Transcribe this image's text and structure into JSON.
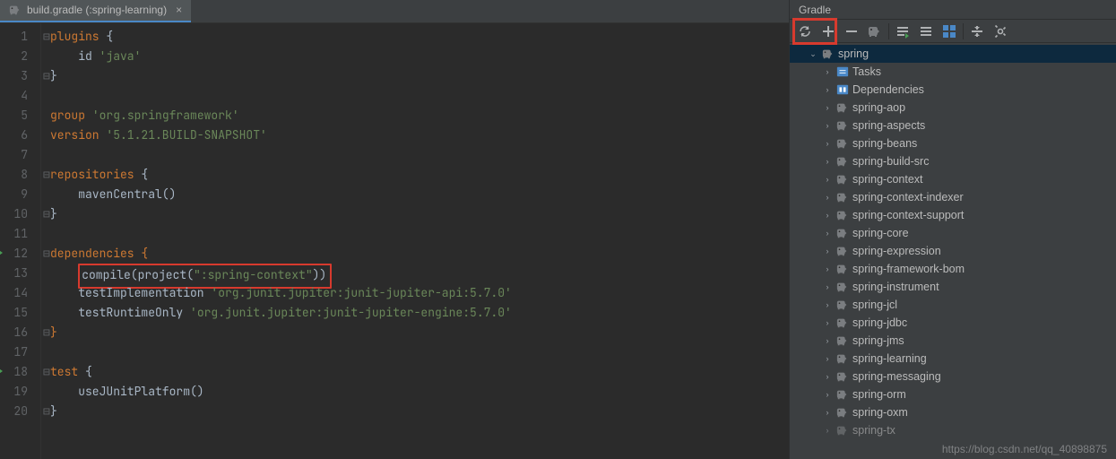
{
  "tab": {
    "label": "build.gradle (:spring-learning)"
  },
  "gutter": {
    "run_lines": [
      12,
      18
    ]
  },
  "code": {
    "lines": [
      {
        "n": 1,
        "fold": "⊟",
        "spans": [
          [
            "plugins ",
            "kw"
          ],
          [
            "{",
            "br"
          ]
        ]
      },
      {
        "n": 2,
        "spans": [
          [
            "    id ",
            "fn"
          ],
          [
            "'java'",
            "str"
          ]
        ]
      },
      {
        "n": 3,
        "fold": "⊟",
        "spans": [
          [
            "}",
            "br"
          ]
        ]
      },
      {
        "n": 4,
        "spans": []
      },
      {
        "n": 5,
        "spans": [
          [
            "group ",
            "kw"
          ],
          [
            "'org.springframework'",
            "str"
          ]
        ]
      },
      {
        "n": 6,
        "spans": [
          [
            "version ",
            "kw"
          ],
          [
            "'5.1.21.BUILD-SNAPSHOT'",
            "str"
          ]
        ]
      },
      {
        "n": 7,
        "spans": []
      },
      {
        "n": 8,
        "fold": "⊟",
        "spans": [
          [
            "repositories ",
            "kw"
          ],
          [
            "{",
            "br"
          ]
        ]
      },
      {
        "n": 9,
        "spans": [
          [
            "    mavenCentral()",
            "fn"
          ]
        ]
      },
      {
        "n": 10,
        "fold": "⊟",
        "spans": [
          [
            "}",
            "br"
          ]
        ]
      },
      {
        "n": 11,
        "spans": []
      },
      {
        "n": 12,
        "fold": "⊟",
        "spans": [
          [
            "dependencies ",
            "kw"
          ],
          [
            "{",
            "brc"
          ]
        ]
      },
      {
        "n": 13,
        "hl": true,
        "spans": [
          [
            "    compile(project(",
            "fn"
          ],
          [
            "\":spring-context\"",
            "str"
          ],
          [
            "))",
            "fn"
          ]
        ]
      },
      {
        "n": 14,
        "spans": [
          [
            "    testImplementation ",
            "fn"
          ],
          [
            "'org.junit.jupiter:junit-jupiter-api:5.7.0'",
            "str"
          ]
        ]
      },
      {
        "n": 15,
        "spans": [
          [
            "    testRuntimeOnly ",
            "fn"
          ],
          [
            "'org.junit.jupiter:junit-jupiter-engine:5.7.0'",
            "str"
          ]
        ]
      },
      {
        "n": 16,
        "fold": "⊟",
        "spans": [
          [
            "}",
            "brc"
          ]
        ]
      },
      {
        "n": 17,
        "spans": []
      },
      {
        "n": 18,
        "fold": "⊟",
        "spans": [
          [
            "test ",
            "kw"
          ],
          [
            "{",
            "br"
          ]
        ]
      },
      {
        "n": 19,
        "spans": [
          [
            "    useJUnitPlatform()",
            "fn"
          ]
        ]
      },
      {
        "n": 20,
        "fold": "⊟",
        "spans": [
          [
            "}",
            "br"
          ]
        ]
      }
    ]
  },
  "side": {
    "title": "Gradle",
    "toolbar": [
      "refresh",
      "add",
      "remove",
      "elephant",
      "sep",
      "execute",
      "toggle",
      "grid",
      "sep",
      "collapse",
      "settings"
    ],
    "tree": {
      "root": {
        "label": "spring",
        "icon": "elephant",
        "selected": true
      },
      "children": [
        {
          "label": "Tasks",
          "icon": "tasks"
        },
        {
          "label": "Dependencies",
          "icon": "deps"
        },
        {
          "label": "spring-aop",
          "icon": "elephant"
        },
        {
          "label": "spring-aspects",
          "icon": "elephant"
        },
        {
          "label": "spring-beans",
          "icon": "elephant"
        },
        {
          "label": "spring-build-src",
          "icon": "elephant"
        },
        {
          "label": "spring-context",
          "icon": "elephant"
        },
        {
          "label": "spring-context-indexer",
          "icon": "elephant"
        },
        {
          "label": "spring-context-support",
          "icon": "elephant"
        },
        {
          "label": "spring-core",
          "icon": "elephant"
        },
        {
          "label": "spring-expression",
          "icon": "elephant"
        },
        {
          "label": "spring-framework-bom",
          "icon": "elephant"
        },
        {
          "label": "spring-instrument",
          "icon": "elephant"
        },
        {
          "label": "spring-jcl",
          "icon": "elephant"
        },
        {
          "label": "spring-jdbc",
          "icon": "elephant"
        },
        {
          "label": "spring-jms",
          "icon": "elephant"
        },
        {
          "label": "spring-learning",
          "icon": "elephant"
        },
        {
          "label": "spring-messaging",
          "icon": "elephant"
        },
        {
          "label": "spring-orm",
          "icon": "elephant"
        },
        {
          "label": "spring-oxm",
          "icon": "elephant"
        },
        {
          "label": "spring-tx",
          "icon": "elephant",
          "partial": true
        }
      ]
    }
  },
  "watermark": "https://blog.csdn.net/qq_40898875"
}
